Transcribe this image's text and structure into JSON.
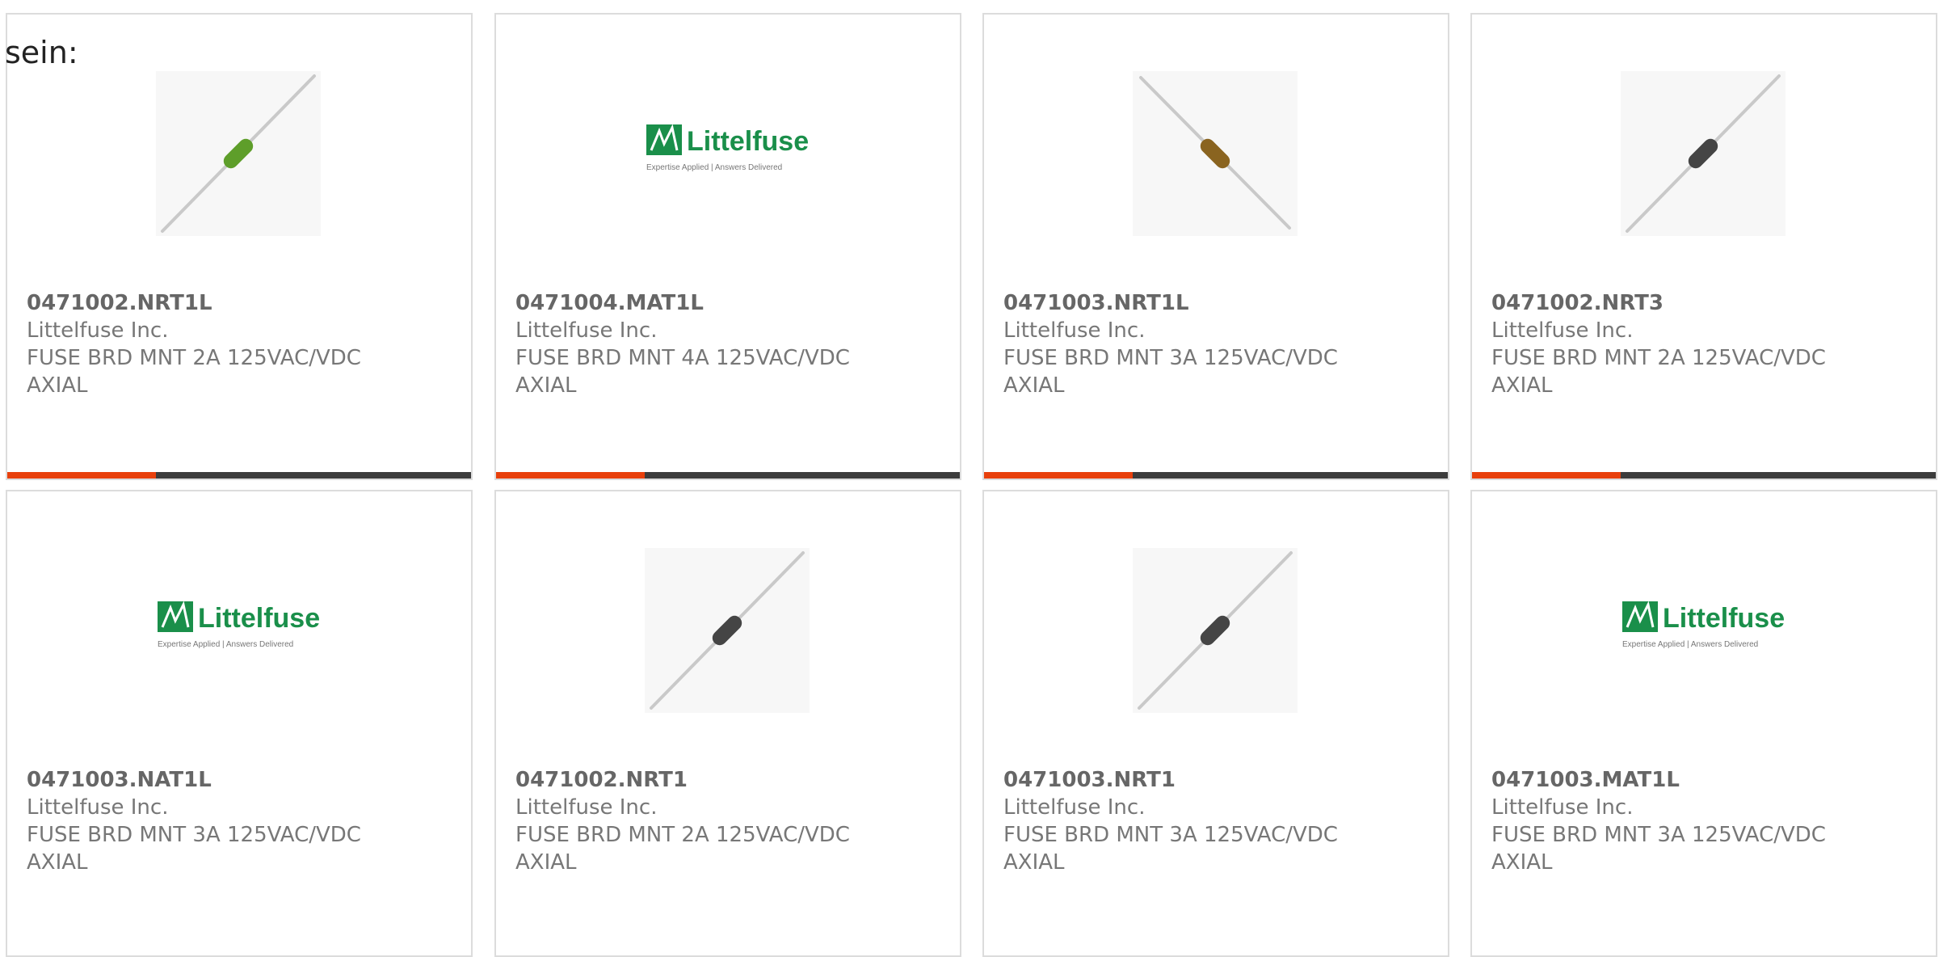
{
  "page": {
    "lead_text": "sein:"
  },
  "colors": {
    "bar_progress": "#e8400c",
    "bar_track": "#3c3c3c",
    "brand_green": "#1a8f4a"
  },
  "logo": {
    "wordmark": "Littelfuse",
    "tagline": "Expertise Applied | Answers Delivered"
  },
  "cards": [
    {
      "part_number": "0471002.NRT1L",
      "manufacturer": "Littelfuse Inc.",
      "description": "FUSE BRD MNT 2A 125VAC/VDC AXIAL",
      "image": "fuse-green-icon",
      "body_color": "#5e9e2a",
      "direction": "up",
      "progress": 0.32
    },
    {
      "part_number": "0471004.MAT1L",
      "manufacturer": "Littelfuse Inc.",
      "description": "FUSE BRD MNT 4A 125VAC/VDC AXIAL",
      "image": "littelfuse-logo",
      "progress": 0.32
    },
    {
      "part_number": "0471003.NRT1L",
      "manufacturer": "Littelfuse Inc.",
      "description": "FUSE BRD MNT 3A 125VAC/VDC AXIAL",
      "image": "fuse-brown-icon",
      "body_color": "#8a6420",
      "direction": "down",
      "progress": 0.32
    },
    {
      "part_number": "0471002.NRT3",
      "manufacturer": "Littelfuse Inc.",
      "description": "FUSE BRD MNT 2A 125VAC/VDC AXIAL",
      "image": "fuse-black-icon",
      "body_color": "#454545",
      "direction": "up",
      "progress": 0.32
    },
    {
      "part_number": "0471003.NAT1L",
      "manufacturer": "Littelfuse Inc.",
      "description": "FUSE BRD MNT 3A 125VAC/VDC AXIAL",
      "image": "littelfuse-logo"
    },
    {
      "part_number": "0471002.NRT1",
      "manufacturer": "Littelfuse Inc.",
      "description": "FUSE BRD MNT 2A 125VAC/VDC AXIAL",
      "image": "fuse-black-icon",
      "body_color": "#454545",
      "direction": "up"
    },
    {
      "part_number": "0471003.NRT1",
      "manufacturer": "Littelfuse Inc.",
      "description": "FUSE BRD MNT 3A 125VAC/VDC AXIAL",
      "image": "fuse-black-icon",
      "body_color": "#454545",
      "direction": "up"
    },
    {
      "part_number": "0471003.MAT1L",
      "manufacturer": "Littelfuse Inc.",
      "description": "FUSE BRD MNT 3A 125VAC/VDC AXIAL",
      "image": "littelfuse-logo"
    }
  ]
}
